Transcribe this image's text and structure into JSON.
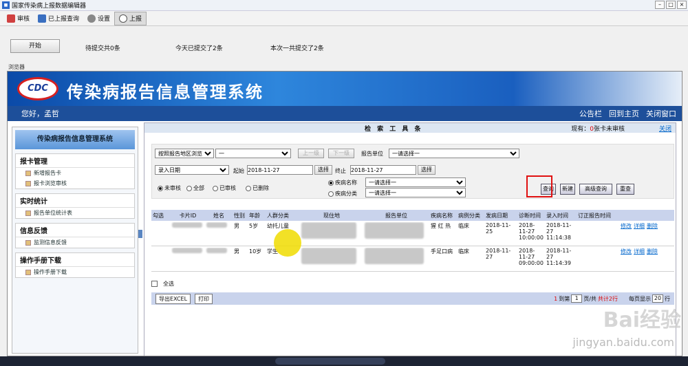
{
  "window": {
    "title": "国家传染病上报数据编辑器"
  },
  "toolbar": {
    "items": [
      {
        "label": "审核",
        "icon": "audit-icon"
      },
      {
        "label": "已上报查询",
        "icon": "query-icon"
      },
      {
        "label": "设置",
        "icon": "gear-icon"
      },
      {
        "label": "上报",
        "icon": "upload-cloud-icon"
      }
    ]
  },
  "status": {
    "start_label": "开始",
    "pending": "待提交共0条",
    "today": "今天已提交了2条",
    "thistime": "本次一共提交了2条"
  },
  "browser": {
    "label": "浏览器"
  },
  "banner": {
    "logo": "CDC",
    "title": "传染病报告信息管理系统"
  },
  "greet": {
    "hello": "您好，孟哲",
    "links": [
      "公告栏",
      "回到主页",
      "关闭窗口"
    ]
  },
  "sidebar": {
    "title": "传染病报告信息管理系统",
    "sections": [
      {
        "header": "报卡管理",
        "items": [
          "新增报告卡",
          "报卡浏览审核"
        ]
      },
      {
        "header": "实时统计",
        "items": [
          "报告单位统计表"
        ]
      },
      {
        "header": "信息反馈",
        "items": [
          "监测信息反馈"
        ]
      },
      {
        "header": "操作手册下载",
        "items": [
          "操作手册下载"
        ]
      }
    ]
  },
  "main": {
    "header": {
      "title": "检 索 工 具 条",
      "info_prefix": "现有：",
      "info_count": "0",
      "info_suffix": "张卡未审核",
      "close": "关闭"
    },
    "filters": {
      "region_select": "按照报告地区浏览",
      "region_value": "一",
      "up_btn": "上一级",
      "down_btn": "下一级",
      "report_unit_label": "报告单位",
      "report_unit_select": "一请选择一",
      "date_type_select": "录入日期",
      "start_label": "起始",
      "start_date": "2018-11-27",
      "choose1": "选择",
      "end_label": "终止",
      "end_date": "2018-11-27",
      "choose2": "选择",
      "status_radios": [
        "未审核",
        "全部",
        "已审核",
        "已删除"
      ],
      "disease_name_label": "疾病名称",
      "disease_name_select": "一请选择一",
      "disease_cat_label": "疾病分类",
      "disease_cat_select": "一请选择一"
    },
    "actions": {
      "query": "查询",
      "new": "新建",
      "advanced": "高级查询",
      "reset": "重查"
    },
    "table": {
      "headers": [
        "勾选",
        "卡片ID",
        "姓名",
        "性别",
        "年龄",
        "人群分类",
        "现住地",
        "报告单位",
        "疾病名称",
        "病例分类",
        "发病日期",
        "诊断时间",
        "录入时间",
        "订正报告时间"
      ],
      "rows": [
        {
          "sex": "男",
          "age": "5岁",
          "group": "幼托儿童",
          "disease": "猩 红 热",
          "case_type": "临床",
          "onset": "2018-11-25",
          "diag": "2018-11-27 10:00:00",
          "entry": "2018-11-27 11:14:38"
        },
        {
          "sex": "男",
          "age": "10岁",
          "group": "学生",
          "disease": "手足口病",
          "case_type": "临床",
          "onset": "2018-11-27",
          "diag": "2018-11-27 09:00:00",
          "entry": "2018-11-27 11:14:39"
        }
      ],
      "row_links": [
        "修改",
        "详细",
        "删除"
      ]
    },
    "select_all": "全选",
    "pager": {
      "export": "导出EXCEL",
      "print": "打印",
      "page_prefix": "1",
      "goto": "到第",
      "page_input": "1",
      "page_suffix": "页/共",
      "total": "共计2行",
      "per_page_label": "每页显示",
      "per_page": "20",
      "rows_suffix": "行"
    }
  },
  "watermark": {
    "brand": "Bai经验",
    "url": "jingyan.baidu.com"
  }
}
